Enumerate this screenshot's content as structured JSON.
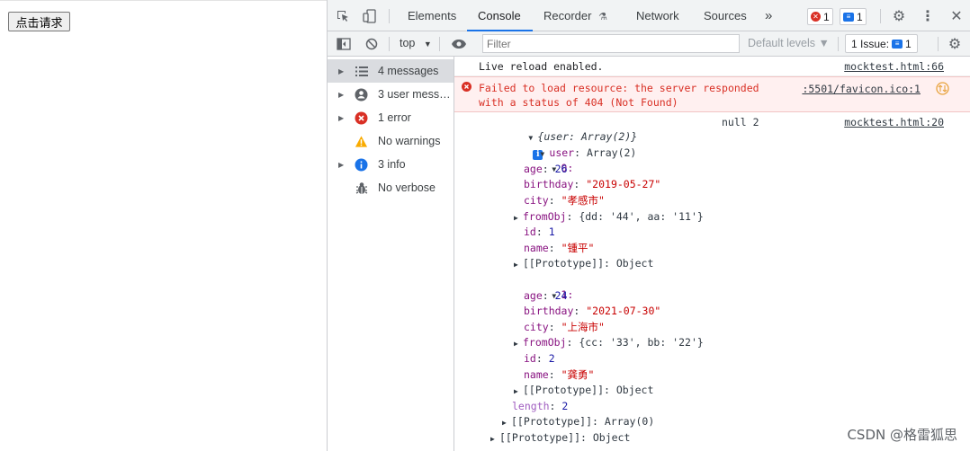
{
  "page": {
    "button_label": "点击请求"
  },
  "devtools": {
    "tabs": [
      "Elements",
      "Console",
      "Recorder",
      "Network",
      "Sources"
    ],
    "active_tab": "Console",
    "more_tabs": "»",
    "error_count": "1",
    "message_count": "1",
    "toolbar": {
      "context": "top",
      "filter_placeholder": "Filter",
      "levels": "Default levels ▼",
      "issues_label": "1 Issue:",
      "issues_count": "1"
    }
  },
  "sidebar": {
    "items": [
      {
        "label": "4 messages",
        "icon": "list-icon"
      },
      {
        "label": "3 user mess…",
        "icon": "user-icon"
      },
      {
        "label": "1 error",
        "icon": "error-icon"
      },
      {
        "label": "No warnings",
        "icon": "warning-icon"
      },
      {
        "label": "3 info",
        "icon": "info-icon"
      },
      {
        "label": "No verbose",
        "icon": "bug-icon"
      }
    ]
  },
  "console": {
    "live_reload": {
      "text": "Live reload enabled.",
      "source": "mocktest.html:66"
    },
    "error": {
      "line1": "Failed to load resource: the server responded",
      "line2": "with a status of 404 (Not Found)",
      "source": ":5501/favicon.ico:1"
    },
    "log": {
      "summary": "{user: Array(2)}",
      "null_label": "null 2",
      "source": "mocktest.html:20",
      "user_key": "user",
      "user_value": "Array(2)",
      "items": [
        {
          "index": "0",
          "age": "26",
          "birthday": "\"2019-05-27\"",
          "city": "\"孝感市\"",
          "fromObj": "{dd: '44', aa: '11'}",
          "id": "1",
          "name": "\"锺平\""
        },
        {
          "index": "1",
          "age": "24",
          "birthday": "\"2021-07-30\"",
          "city": "\"上海市\"",
          "fromObj": "{cc: '33', bb: '22'}",
          "id": "2",
          "name": "\"龚勇\""
        }
      ],
      "proto_object": "[[Prototype]]: Object",
      "length_key": "length",
      "length_value": "2",
      "proto_array": "[[Prototype]]: Array(0)",
      "proto_outer": "[[Prototype]]: Object"
    }
  },
  "watermark": "CSDN @格雷狐思",
  "colors": {
    "accent": "#1a73e8",
    "error": "#d93025",
    "key": "#881280",
    "string": "#c80000",
    "number": "#1a1aa6"
  }
}
